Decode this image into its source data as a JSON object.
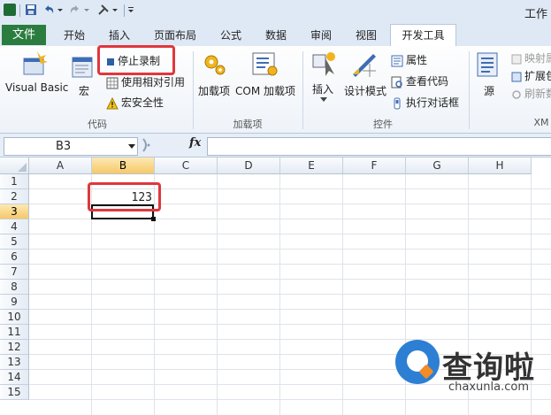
{
  "window": {
    "title": "工作"
  },
  "tabs": [
    {
      "label": "文件"
    },
    {
      "label": "开始"
    },
    {
      "label": "插入"
    },
    {
      "label": "页面布局"
    },
    {
      "label": "公式"
    },
    {
      "label": "数据"
    },
    {
      "label": "审阅"
    },
    {
      "label": "视图"
    },
    {
      "label": "开发工具"
    }
  ],
  "ribbon": {
    "code_group": {
      "label": "代码",
      "visual_basic": "Visual Basic",
      "macros": "宏",
      "stop_recording": "停止录制",
      "use_relative": "使用相对引用",
      "macro_security": "宏安全性"
    },
    "addins_group": {
      "label": "加载项",
      "addins": "加载项",
      "com_addins": "COM 加载项"
    },
    "controls_group": {
      "label": "控件",
      "insert": "插入",
      "design_mode": "设计模式",
      "properties": "属性",
      "view_code": "查看代码",
      "run_dialog": "执行对话框"
    },
    "xml_group": {
      "label": "XM",
      "source": "源",
      "map_props": "映射属",
      "expansion": "扩展包",
      "refresh": "刷新数"
    }
  },
  "formula_bar": {
    "name_box": "B3",
    "fx": "fx",
    "value": ""
  },
  "columns": [
    "A",
    "B",
    "C",
    "D",
    "E",
    "F",
    "G",
    "H"
  ],
  "rows": [
    "1",
    "2",
    "3",
    "4",
    "5",
    "6",
    "7",
    "8",
    "9",
    "10",
    "11",
    "12",
    "13",
    "14",
    "15"
  ],
  "cells": {
    "B2": "123"
  },
  "selection": {
    "column": "B",
    "row": "3"
  },
  "watermark": {
    "name": "查询啦",
    "url": "chaxunla.com"
  },
  "colors": {
    "file_tab": "#2a7d3f",
    "highlight": "#e0373c",
    "selected_header": "#f6c86a",
    "watermark": "#2d7fd3"
  }
}
